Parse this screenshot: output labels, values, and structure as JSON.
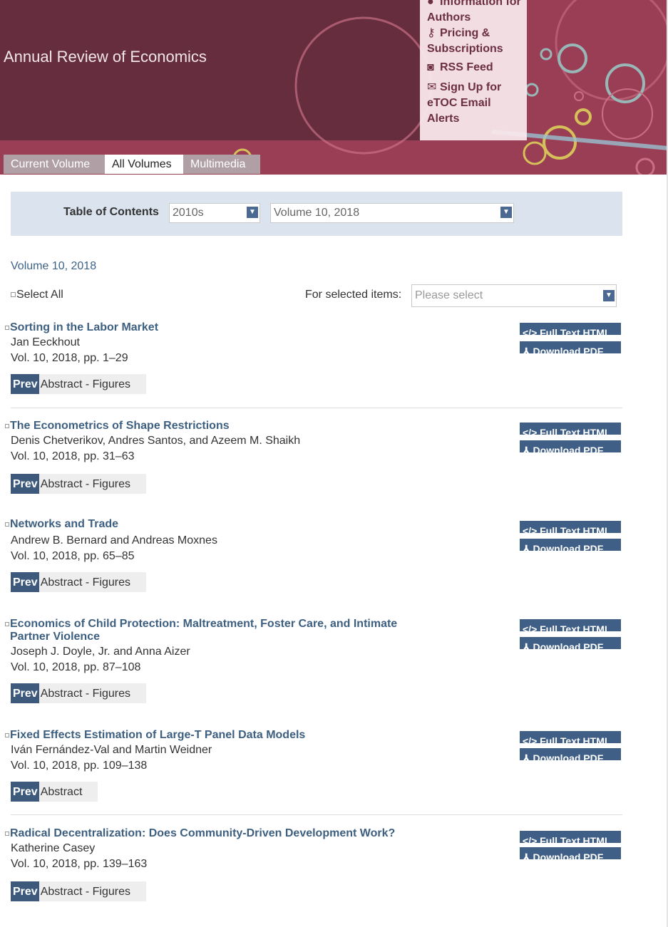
{
  "site": {
    "title": "Annual Review of Economics",
    "info_menu": [
      {
        "icon": "info-icon",
        "label": "Information for Authors"
      },
      {
        "icon": "key-icon",
        "label": "Pricing & Subscriptions"
      },
      {
        "icon": "rss-icon",
        "label": "RSS Feed"
      },
      {
        "icon": "envelope-icon",
        "label": "Sign Up for eTOC Email Alerts"
      }
    ]
  },
  "tabs": [
    {
      "label": "Current Volume",
      "active": false
    },
    {
      "label": "All Volumes",
      "active": true
    },
    {
      "label": "Multimedia",
      "active": false
    }
  ],
  "toc": {
    "label": "Table of Contents",
    "decade_select": "2010s",
    "volume_select": "Volume 10, 2018"
  },
  "volume_heading": "Volume 10, 2018",
  "select_all": "Select All",
  "for_selected": {
    "label": "For selected items:",
    "placeholder": "Please select"
  },
  "buttons": {
    "full_text": "</> Full Text HTML",
    "download_pdf": "⅄ Download PDF",
    "preview": "Prev"
  },
  "articles": [
    {
      "title": "Sorting in the Labor Market",
      "authors": "Jan Eeckhout",
      "citation": "Vol. 10, 2018, pp. 1–29",
      "preview_label": "Abstract - Figures"
    },
    {
      "title": "The Econometrics of Shape Restrictions",
      "authors": "Denis Chetverikov, Andres Santos, and Azeem M. Shaikh",
      "citation": "Vol. 10, 2018, pp. 31–63",
      "preview_label": "Abstract - Figures"
    },
    {
      "title": "Networks and Trade",
      "authors": "Andrew B. Bernard and Andreas Moxnes",
      "citation": "Vol. 10, 2018, pp. 65–85",
      "preview_label": "Abstract - Figures"
    },
    {
      "title": "Economics of Child Protection: Maltreatment, Foster Care, and Intimate Partner Violence",
      "authors": "Joseph J. Doyle, Jr. and Anna Aizer",
      "citation": "Vol. 10, 2018, pp. 87–108",
      "preview_label": "Abstract - Figures"
    },
    {
      "title": "Fixed Effects Estimation of Large-T Panel Data Models",
      "authors": "Iván Fernández-Val and Martin Weidner",
      "citation": "Vol. 10, 2018, pp. 109–138",
      "preview_label": "Abstract"
    },
    {
      "title": "Radical Decentralization: Does Community-Driven Development Work?",
      "authors": "Katherine Casey",
      "citation": "Vol. 10, 2018, pp. 139–163",
      "preview_label": "Abstract - Figures"
    }
  ],
  "colors": {
    "header_dark": "#652d3d",
    "header_light": "#9a3e55",
    "link": "#3d5f80",
    "button": "#3f5f86",
    "toc_panel": "#dbe4ee"
  }
}
